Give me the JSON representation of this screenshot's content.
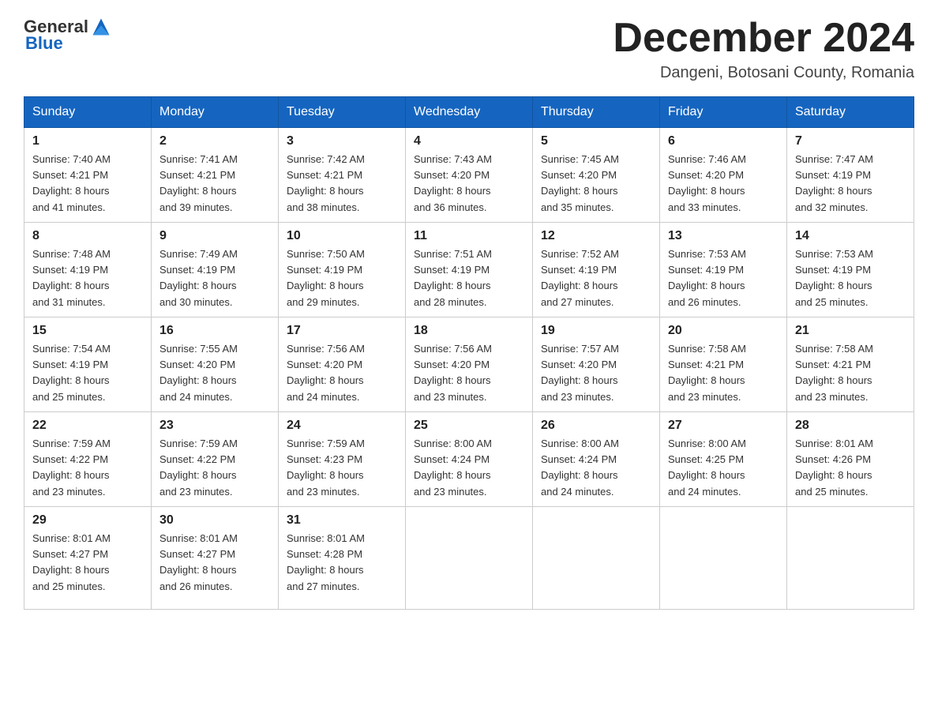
{
  "header": {
    "logo_general": "General",
    "logo_blue": "Blue",
    "title": "December 2024",
    "subtitle": "Dangeni, Botosani County, Romania"
  },
  "days_of_week": [
    "Sunday",
    "Monday",
    "Tuesday",
    "Wednesday",
    "Thursday",
    "Friday",
    "Saturday"
  ],
  "weeks": [
    [
      {
        "day": "1",
        "sunrise": "7:40 AM",
        "sunset": "4:21 PM",
        "daylight": "8 hours and 41 minutes."
      },
      {
        "day": "2",
        "sunrise": "7:41 AM",
        "sunset": "4:21 PM",
        "daylight": "8 hours and 39 minutes."
      },
      {
        "day": "3",
        "sunrise": "7:42 AM",
        "sunset": "4:21 PM",
        "daylight": "8 hours and 38 minutes."
      },
      {
        "day": "4",
        "sunrise": "7:43 AM",
        "sunset": "4:20 PM",
        "daylight": "8 hours and 36 minutes."
      },
      {
        "day": "5",
        "sunrise": "7:45 AM",
        "sunset": "4:20 PM",
        "daylight": "8 hours and 35 minutes."
      },
      {
        "day": "6",
        "sunrise": "7:46 AM",
        "sunset": "4:20 PM",
        "daylight": "8 hours and 33 minutes."
      },
      {
        "day": "7",
        "sunrise": "7:47 AM",
        "sunset": "4:19 PM",
        "daylight": "8 hours and 32 minutes."
      }
    ],
    [
      {
        "day": "8",
        "sunrise": "7:48 AM",
        "sunset": "4:19 PM",
        "daylight": "8 hours and 31 minutes."
      },
      {
        "day": "9",
        "sunrise": "7:49 AM",
        "sunset": "4:19 PM",
        "daylight": "8 hours and 30 minutes."
      },
      {
        "day": "10",
        "sunrise": "7:50 AM",
        "sunset": "4:19 PM",
        "daylight": "8 hours and 29 minutes."
      },
      {
        "day": "11",
        "sunrise": "7:51 AM",
        "sunset": "4:19 PM",
        "daylight": "8 hours and 28 minutes."
      },
      {
        "day": "12",
        "sunrise": "7:52 AM",
        "sunset": "4:19 PM",
        "daylight": "8 hours and 27 minutes."
      },
      {
        "day": "13",
        "sunrise": "7:53 AM",
        "sunset": "4:19 PM",
        "daylight": "8 hours and 26 minutes."
      },
      {
        "day": "14",
        "sunrise": "7:53 AM",
        "sunset": "4:19 PM",
        "daylight": "8 hours and 25 minutes."
      }
    ],
    [
      {
        "day": "15",
        "sunrise": "7:54 AM",
        "sunset": "4:19 PM",
        "daylight": "8 hours and 25 minutes."
      },
      {
        "day": "16",
        "sunrise": "7:55 AM",
        "sunset": "4:20 PM",
        "daylight": "8 hours and 24 minutes."
      },
      {
        "day": "17",
        "sunrise": "7:56 AM",
        "sunset": "4:20 PM",
        "daylight": "8 hours and 24 minutes."
      },
      {
        "day": "18",
        "sunrise": "7:56 AM",
        "sunset": "4:20 PM",
        "daylight": "8 hours and 23 minutes."
      },
      {
        "day": "19",
        "sunrise": "7:57 AM",
        "sunset": "4:20 PM",
        "daylight": "8 hours and 23 minutes."
      },
      {
        "day": "20",
        "sunrise": "7:58 AM",
        "sunset": "4:21 PM",
        "daylight": "8 hours and 23 minutes."
      },
      {
        "day": "21",
        "sunrise": "7:58 AM",
        "sunset": "4:21 PM",
        "daylight": "8 hours and 23 minutes."
      }
    ],
    [
      {
        "day": "22",
        "sunrise": "7:59 AM",
        "sunset": "4:22 PM",
        "daylight": "8 hours and 23 minutes."
      },
      {
        "day": "23",
        "sunrise": "7:59 AM",
        "sunset": "4:22 PM",
        "daylight": "8 hours and 23 minutes."
      },
      {
        "day": "24",
        "sunrise": "7:59 AM",
        "sunset": "4:23 PM",
        "daylight": "8 hours and 23 minutes."
      },
      {
        "day": "25",
        "sunrise": "8:00 AM",
        "sunset": "4:24 PM",
        "daylight": "8 hours and 23 minutes."
      },
      {
        "day": "26",
        "sunrise": "8:00 AM",
        "sunset": "4:24 PM",
        "daylight": "8 hours and 24 minutes."
      },
      {
        "day": "27",
        "sunrise": "8:00 AM",
        "sunset": "4:25 PM",
        "daylight": "8 hours and 24 minutes."
      },
      {
        "day": "28",
        "sunrise": "8:01 AM",
        "sunset": "4:26 PM",
        "daylight": "8 hours and 25 minutes."
      }
    ],
    [
      {
        "day": "29",
        "sunrise": "8:01 AM",
        "sunset": "4:27 PM",
        "daylight": "8 hours and 25 minutes."
      },
      {
        "day": "30",
        "sunrise": "8:01 AM",
        "sunset": "4:27 PM",
        "daylight": "8 hours and 26 minutes."
      },
      {
        "day": "31",
        "sunrise": "8:01 AM",
        "sunset": "4:28 PM",
        "daylight": "8 hours and 27 minutes."
      },
      null,
      null,
      null,
      null
    ]
  ],
  "labels": {
    "sunrise": "Sunrise:",
    "sunset": "Sunset:",
    "daylight": "Daylight:"
  }
}
